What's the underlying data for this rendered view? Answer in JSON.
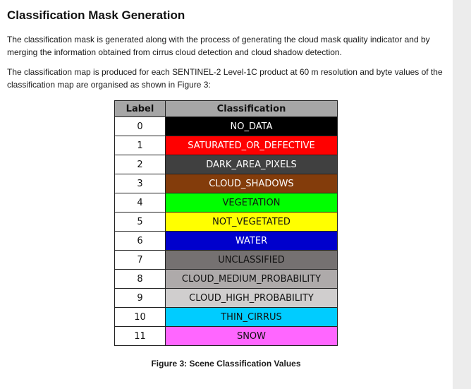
{
  "heading": "Classification Mask Generation",
  "paragraph_1": "The classification mask is generated along with the process of generating the cloud mask quality indicator and by merging the information obtained from cirrus cloud detection and cloud shadow detection.",
  "paragraph_2": "The classification map is produced for each SENTINEL-2 Level-1C product at 60 m resolution and byte values of the classification map are organised as shown in Figure 3:",
  "table": {
    "headers": [
      "Label",
      "Classification"
    ],
    "rows": [
      {
        "label": "0",
        "classification": "NO_DATA",
        "bg": "#000000",
        "fg": "#ffffff"
      },
      {
        "label": "1",
        "classification": "SATURATED_OR_DEFECTIVE",
        "bg": "#ff0000",
        "fg": "#ffffff"
      },
      {
        "label": "2",
        "classification": "DARK_AREA_PIXELS",
        "bg": "#404040",
        "fg": "#ffffff"
      },
      {
        "label": "3",
        "classification": "CLOUD_SHADOWS",
        "bg": "#833c0b",
        "fg": "#ffffff"
      },
      {
        "label": "4",
        "classification": "VEGETATION",
        "bg": "#00ff00",
        "fg": "#111111"
      },
      {
        "label": "5",
        "classification": "NOT_VEGETATED",
        "bg": "#ffff00",
        "fg": "#111111"
      },
      {
        "label": "6",
        "classification": "WATER",
        "bg": "#0000cc",
        "fg": "#ffffff"
      },
      {
        "label": "7",
        "classification": "UNCLASSIFIED",
        "bg": "#757171",
        "fg": "#111111"
      },
      {
        "label": "8",
        "classification": "CLOUD_MEDIUM_PROBABILITY",
        "bg": "#aeaaaa",
        "fg": "#111111"
      },
      {
        "label": "9",
        "classification": "CLOUD_HIGH_PROBABILITY",
        "bg": "#d0cece",
        "fg": "#111111"
      },
      {
        "label": "10",
        "classification": "THIN_CIRRUS",
        "bg": "#00ccff",
        "fg": "#111111"
      },
      {
        "label": "11",
        "classification": "SNOW",
        "bg": "#ff66ff",
        "fg": "#111111"
      }
    ]
  },
  "caption": "Figure 3: Scene Classification Values"
}
